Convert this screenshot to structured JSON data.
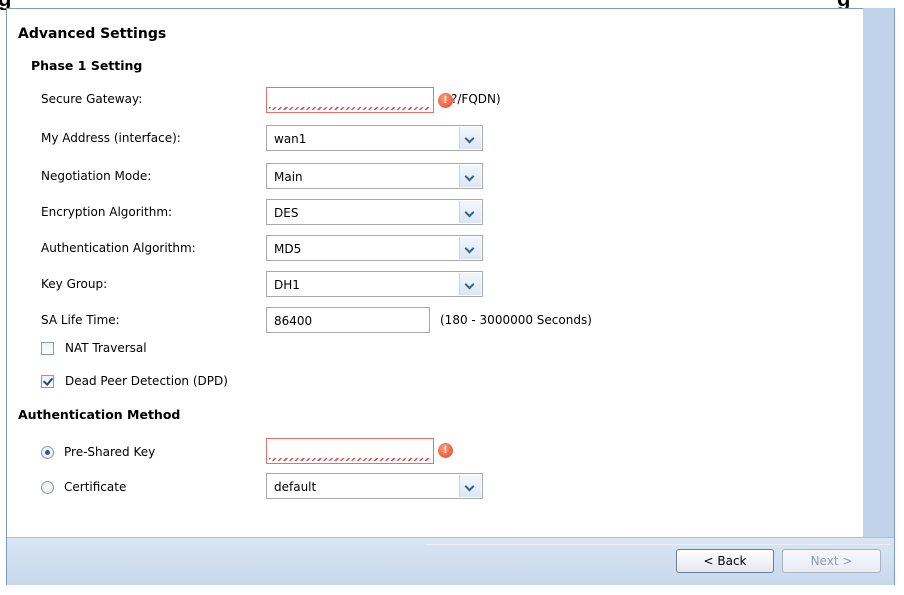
{
  "header_fragment": {
    "left": "g",
    "right": "g"
  },
  "section_title": "Advanced Settings",
  "phase1": {
    "heading": "Phase 1 Setting",
    "secure_gateway": {
      "label": "Secure Gateway:",
      "value": "",
      "hint": "?/FQDN)"
    },
    "my_address": {
      "label": "My Address (interface):",
      "value": "wan1"
    },
    "negotiation_mode": {
      "label": "Negotiation Mode:",
      "value": "Main"
    },
    "encryption": {
      "label": "Encryption Algorithm:",
      "value": "DES"
    },
    "authentication": {
      "label": "Authentication Algorithm:",
      "value": "MD5"
    },
    "key_group": {
      "label": "Key Group:",
      "value": "DH1"
    },
    "sa_life": {
      "label": "SA Life Time:",
      "value": "86400",
      "hint": "(180 - 3000000 Seconds)"
    },
    "nat_traversal": {
      "label": "NAT Traversal",
      "checked": false
    },
    "dpd": {
      "label": "Dead Peer Detection (DPD)",
      "checked": true
    }
  },
  "auth_method": {
    "heading": "Authentication Method",
    "pre_shared_key": {
      "label": "Pre-Shared Key",
      "selected": true,
      "value": ""
    },
    "certificate": {
      "label": "Certificate",
      "selected": false,
      "value": "default"
    }
  },
  "error_icon_glyph": "!",
  "footer": {
    "back_label": "< Back",
    "next_label": "Next >"
  }
}
